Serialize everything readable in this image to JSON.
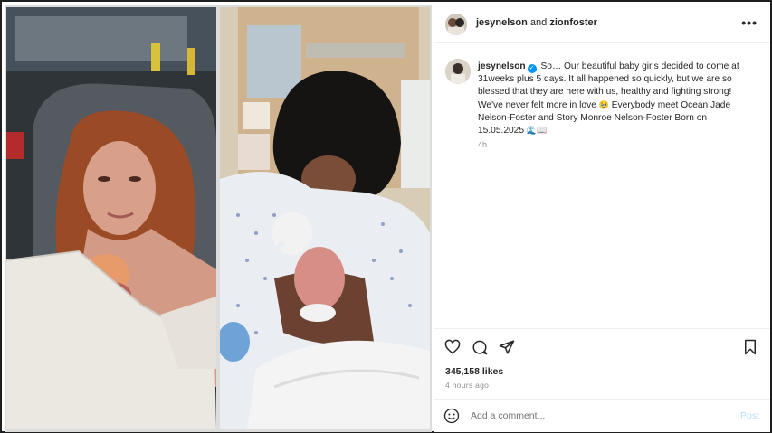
{
  "header": {
    "author_primary": "jesynelson",
    "author_connector": "and",
    "author_collab": "zionfoster",
    "more_icon": "more-horizontal-icon"
  },
  "caption": {
    "username": "jesynelson",
    "verified_icon": "verified-badge-icon",
    "line1": "So… Our beautiful baby girls decided to come at 31weeks plus 5 days. It all happened so quickly, but we are so blessed that they are here with us, healthy and fighting strong! We've never felt more in love",
    "emoji1": "🥹",
    "line2": "Everybody meet Ocean Jade Nelson-Foster and Story Monroe Nelson-Foster Born on 15.05.2025",
    "emoji2": "🌊📖",
    "time": "4h"
  },
  "actions": {
    "like_icon": "heart-icon",
    "comment_icon": "comment-icon",
    "share_icon": "send-icon",
    "save_icon": "bookmark-icon"
  },
  "likes": "345,158 likes",
  "posted_ago": "4 hours ago",
  "comment": {
    "emoji_icon": "smiley-icon",
    "placeholder": "Add a comment...",
    "post_label": "Post"
  },
  "colors": {
    "accent": "#0095f6",
    "post_disabled": "#b2dffc",
    "text": "#262626",
    "muted": "#8e8e8e"
  }
}
